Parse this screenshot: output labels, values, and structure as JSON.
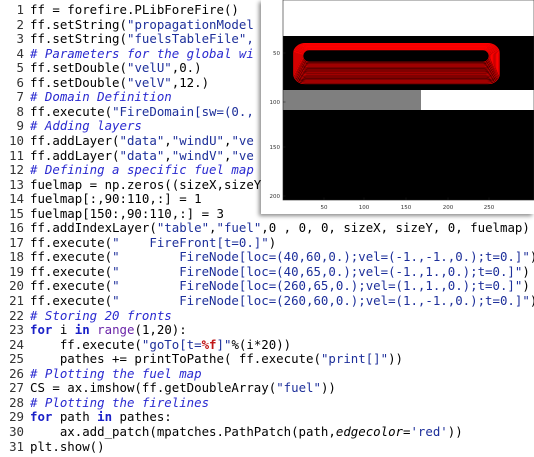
{
  "code_lines": [
    {
      "n": "1",
      "parts": [
        {
          "t": "ff = forefire.PLibForeFire()"
        }
      ]
    },
    {
      "n": "2",
      "parts": [
        {
          "t": "ff.setString("
        },
        {
          "t": "\"propagationModel",
          "c": "str"
        }
      ]
    },
    {
      "n": "3",
      "parts": [
        {
          "t": "ff.setString("
        },
        {
          "t": "\"fuelsTableFile\",",
          "c": "str"
        }
      ]
    },
    {
      "n": "4",
      "parts": [
        {
          "t": "# Parameters for the global wi",
          "c": "cm"
        }
      ]
    },
    {
      "n": "5",
      "parts": [
        {
          "t": "ff.setDouble("
        },
        {
          "t": "\"velU\"",
          "c": "str"
        },
        {
          "t": ",0.)"
        }
      ]
    },
    {
      "n": "6",
      "parts": [
        {
          "t": "ff.setDouble("
        },
        {
          "t": "\"velV\"",
          "c": "str"
        },
        {
          "t": ",12.)"
        }
      ]
    },
    {
      "n": "7",
      "parts": [
        {
          "t": "# Domain Definition",
          "c": "cm"
        }
      ]
    },
    {
      "n": "8",
      "parts": [
        {
          "t": "ff.execute("
        },
        {
          "t": "\"FireDomain[sw=(0.,",
          "c": "str"
        }
      ]
    },
    {
      "n": "9",
      "parts": [
        {
          "t": "# Adding layers",
          "c": "cm"
        }
      ]
    },
    {
      "n": "10",
      "parts": [
        {
          "t": "ff.addLayer("
        },
        {
          "t": "\"data\"",
          "c": "str"
        },
        {
          "t": ","
        },
        {
          "t": "\"windU\"",
          "c": "str"
        },
        {
          "t": ","
        },
        {
          "t": "\"ve",
          "c": "str"
        }
      ]
    },
    {
      "n": "11",
      "parts": [
        {
          "t": "ff.addLayer("
        },
        {
          "t": "\"data\"",
          "c": "str"
        },
        {
          "t": ","
        },
        {
          "t": "\"windV\"",
          "c": "str"
        },
        {
          "t": ","
        },
        {
          "t": "\"ve",
          "c": "str"
        }
      ]
    },
    {
      "n": "12",
      "parts": [
        {
          "t": "# Defining a specific fuel map",
          "c": "cm"
        }
      ]
    },
    {
      "n": "13",
      "parts": [
        {
          "t": "fuelmap = np.zeros((sizeX,sizeY"
        }
      ]
    },
    {
      "n": "14",
      "parts": [
        {
          "t": "fuelmap[:,90:110,:] = 1"
        }
      ]
    },
    {
      "n": "15",
      "parts": [
        {
          "t": "fuelmap[150:,90:110,:] = 3"
        }
      ]
    },
    {
      "n": "16",
      "parts": [
        {
          "t": "ff.addIndexLayer("
        },
        {
          "t": "\"table\"",
          "c": "str"
        },
        {
          "t": ","
        },
        {
          "t": "\"fuel\"",
          "c": "str"
        },
        {
          "t": ",0 , 0, 0, sizeX, sizeY, 0, fuelmap)"
        }
      ]
    },
    {
      "n": "17",
      "parts": [
        {
          "t": "ff.execute("
        },
        {
          "t": "\"    FireFront[t=0.]\"",
          "c": "str"
        },
        {
          "t": ")"
        }
      ]
    },
    {
      "n": "18",
      "parts": [
        {
          "t": "ff.execute("
        },
        {
          "t": "\"        FireNode[loc=(40,60,0.);vel=(-1.,-1.,0.);t=0.]\"",
          "c": "str"
        },
        {
          "t": ")"
        }
      ]
    },
    {
      "n": "19",
      "parts": [
        {
          "t": "ff.execute("
        },
        {
          "t": "\"        FireNode[loc=(40,65,0.);vel=(-1.,1.,0.);t=0.]\"",
          "c": "str"
        },
        {
          "t": ")"
        }
      ]
    },
    {
      "n": "20",
      "parts": [
        {
          "t": "ff.execute("
        },
        {
          "t": "\"        FireNode[loc=(260,65,0.);vel=(1.,1.,0.);t=0.]\"",
          "c": "str"
        },
        {
          "t": ")"
        }
      ]
    },
    {
      "n": "21",
      "parts": [
        {
          "t": "ff.execute("
        },
        {
          "t": "\"        FireNode[loc=(260,60,0.);vel=(1.,-1.,0.);t=0.]\"",
          "c": "str"
        },
        {
          "t": ")"
        }
      ]
    },
    {
      "n": "22",
      "parts": [
        {
          "t": "# Storing 20 fronts",
          "c": "cm"
        }
      ]
    },
    {
      "n": "23",
      "parts": [
        {
          "t": "for",
          "c": "kw"
        },
        {
          "t": " i "
        },
        {
          "t": "in",
          "c": "kw"
        },
        {
          "t": " "
        },
        {
          "t": "range",
          "c": "bi"
        },
        {
          "t": "(1,20):"
        }
      ]
    },
    {
      "n": "24",
      "parts": [
        {
          "t": "    ff.execute("
        },
        {
          "t": "\"goTo[t=",
          "c": "str"
        },
        {
          "t": "%f",
          "c": "fmt"
        },
        {
          "t": "]\"",
          "c": "str"
        },
        {
          "t": "%"
        },
        {
          "t": "(i*20))"
        }
      ]
    },
    {
      "n": "25",
      "parts": [
        {
          "t": "    pathes += printToPathe( ff.execute("
        },
        {
          "t": "\"print[]\"",
          "c": "str"
        },
        {
          "t": "))"
        }
      ]
    },
    {
      "n": "26",
      "parts": [
        {
          "t": "# Plotting the fuel map",
          "c": "cm"
        }
      ]
    },
    {
      "n": "27",
      "parts": [
        {
          "t": "CS = ax.imshow(ff.getDoubleArray("
        },
        {
          "t": "\"fuel\"",
          "c": "str"
        },
        {
          "t": "))"
        }
      ]
    },
    {
      "n": "28",
      "parts": [
        {
          "t": "# Plotting the firelines",
          "c": "cm"
        }
      ]
    },
    {
      "n": "29",
      "parts": [
        {
          "t": "for",
          "c": "kw"
        },
        {
          "t": " path "
        },
        {
          "t": "in",
          "c": "kw"
        },
        {
          "t": " pathes:"
        }
      ]
    },
    {
      "n": "30",
      "parts": [
        {
          "t": "    ax.add_patch(mpatches.PathPatch(path,"
        },
        {
          "t": "edgecolor",
          "c": "it"
        },
        {
          "t": "="
        },
        {
          "t": "'red'",
          "c": "str"
        },
        {
          "t": "))"
        }
      ]
    },
    {
      "n": "31",
      "parts": [
        {
          "t": "plt.show()"
        }
      ]
    }
  ],
  "plot": {
    "x_ticks": [
      "50",
      "100",
      "150",
      "200",
      "250"
    ],
    "y_ticks": [
      "50",
      "100",
      "150",
      "200"
    ],
    "colors": {
      "fuel_dark": "#000000",
      "fuel_gray": "#7f7f7f",
      "fuel_white": "#ffffff",
      "firelines": "#ff0000"
    }
  }
}
